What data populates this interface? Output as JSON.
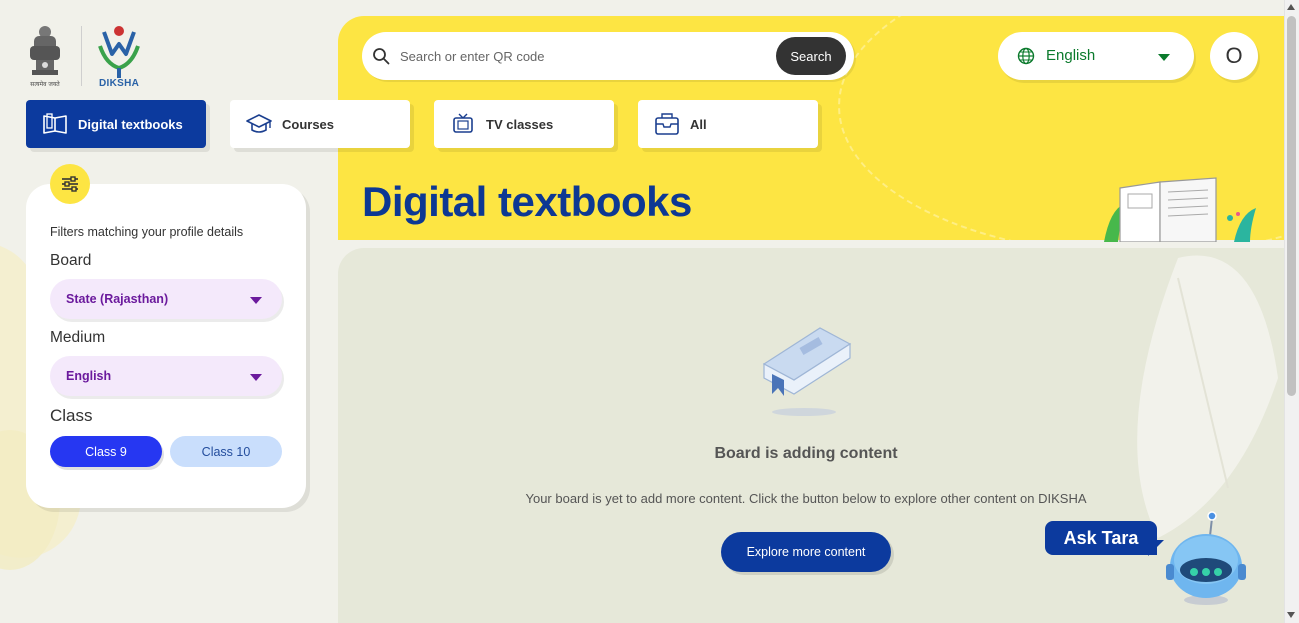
{
  "header": {
    "emblem_caption": "सत्यमेव जयते",
    "brand": "DIKSHA",
    "search": {
      "placeholder": "Search or enter QR code",
      "button_label": "Search"
    },
    "language": {
      "selected": "English"
    },
    "avatar_initial": "O"
  },
  "tabs": [
    {
      "label": "Digital textbooks",
      "icon": "book-open-icon",
      "active": true
    },
    {
      "label": "Courses",
      "icon": "graduation-cap-icon",
      "active": false
    },
    {
      "label": "TV classes",
      "icon": "tv-icon",
      "active": false
    },
    {
      "label": "All",
      "icon": "inbox-icon",
      "active": false
    }
  ],
  "hero": {
    "title": "Digital textbooks"
  },
  "filters": {
    "caption": "Filters matching your profile details",
    "board": {
      "label": "Board",
      "value": "State (Rajasthan)"
    },
    "medium": {
      "label": "Medium",
      "value": "English"
    },
    "class": {
      "label": "Class",
      "options": [
        {
          "label": "Class 9",
          "selected": true
        },
        {
          "label": "Class 10",
          "selected": false
        }
      ]
    }
  },
  "empty_state": {
    "title": "Board is adding content",
    "description": "Your board is yet to add more content. Click the button below to explore other content on DIKSHA",
    "button_label": "Explore more content"
  },
  "assistant": {
    "label": "Ask Tara"
  },
  "colors": {
    "hero_yellow": "#fde543",
    "primary_blue": "#0c3a9e",
    "chip_active": "#2637f2",
    "select_bg": "#f4e9fb",
    "select_text": "#6b1a9d",
    "language_green": "#0b7a2c"
  }
}
